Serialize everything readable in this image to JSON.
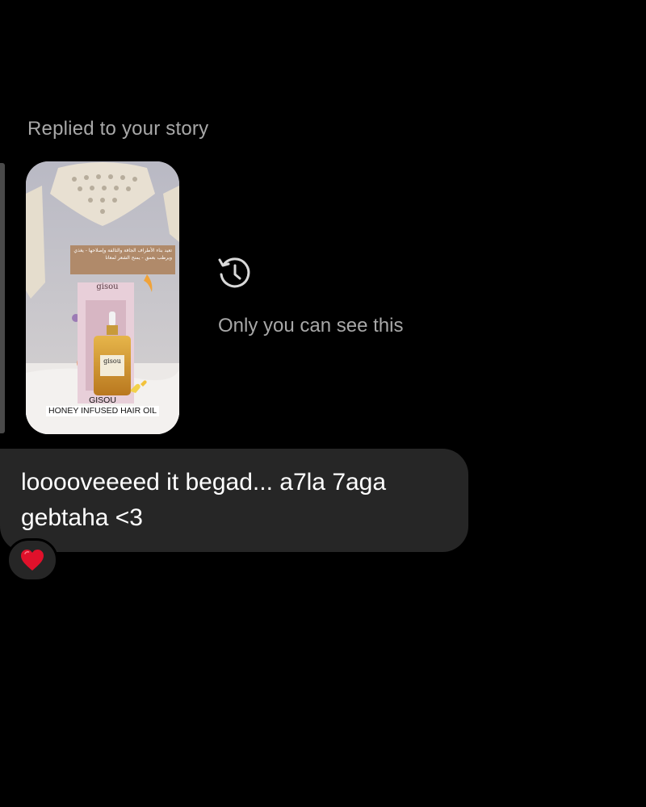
{
  "reply_header": "Replied to your story",
  "story": {
    "arabic_caption": "تعيد بناء الأطراف الجافة والتالفة وإصلاحها - يغذي ويرطب بعمق - يمنح الشعر لمعانا",
    "bottle_brand": "gisou",
    "box_brand": "gisou",
    "caption_brand": "GISOU",
    "caption_product": "HONEY INFUSED HAIR OIL"
  },
  "visibility_note": "Only you can see this",
  "message": {
    "text": "looooveeeed it begad... a7la 7aga gebtaha <3"
  },
  "reaction": {
    "emoji_name": "heart",
    "color": "#e0112b"
  },
  "colors": {
    "background": "#000000",
    "bubble": "#262626",
    "muted_text": "#a8a8a8"
  }
}
